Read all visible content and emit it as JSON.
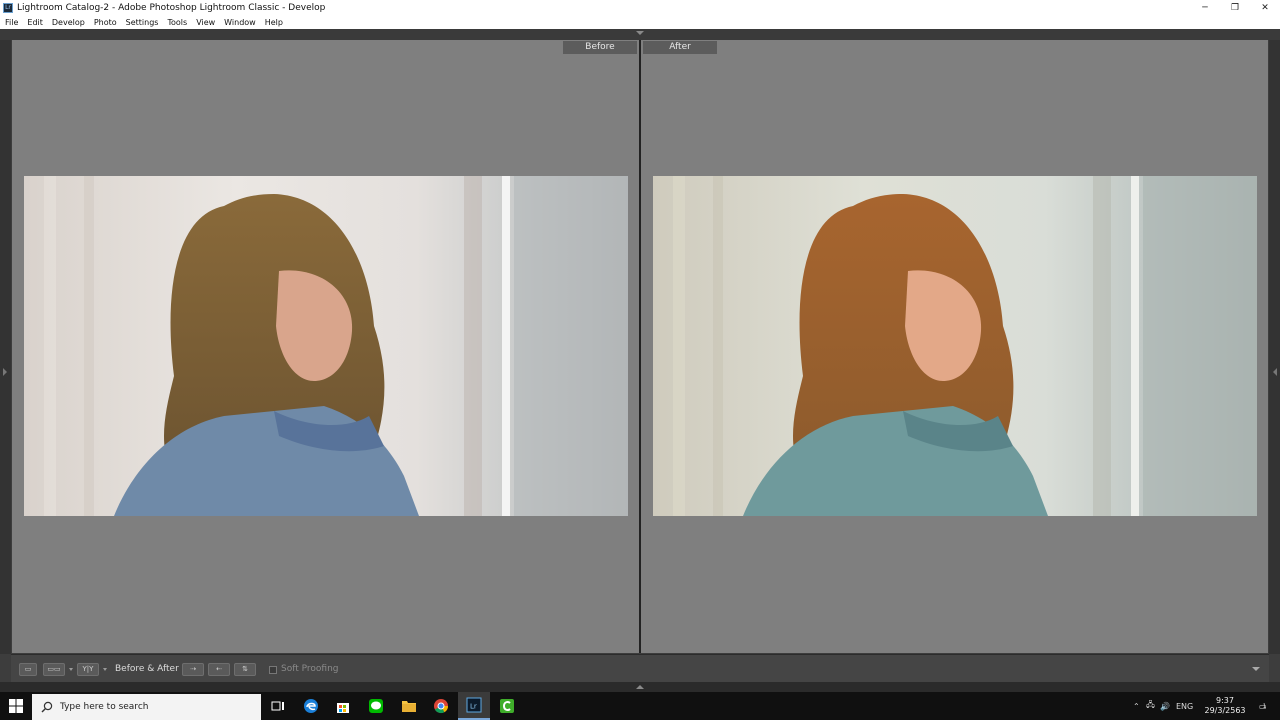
{
  "window": {
    "app_icon": "Lr",
    "title": "Lightroom Catalog-2 - Adobe Photoshop Lightroom Classic - Develop",
    "controls": {
      "minimize": "─",
      "restore": "❐",
      "close": "✕"
    }
  },
  "menu": {
    "items": [
      "File",
      "Edit",
      "Develop",
      "Photo",
      "Settings",
      "Tools",
      "View",
      "Window",
      "Help"
    ]
  },
  "compare": {
    "before_label": "Before",
    "after_label": "After"
  },
  "toolbar": {
    "loupe_icon": "loupe-view-icon",
    "compare_icon": "compare-view-icon",
    "before_after_mode_icon": "before-after-left-right-icon",
    "before_after_label": "Before & After :",
    "copy_before_to_after_icon": "copy-settings-icon",
    "copy_after_to_before_icon": "copy-settings-icon",
    "swap_icon": "swap-icon",
    "soft_proofing_label": "Soft Proofing",
    "soft_proofing_checked": false
  },
  "taskbar": {
    "search_placeholder": "Type here to search",
    "apps": [
      "task-view-icon",
      "edge-icon",
      "store-icon",
      "line-icon",
      "file-explorer-icon",
      "chrome-icon",
      "lightroom-icon",
      "camtasia-icon"
    ],
    "active_app": "lightroom-icon",
    "language": "ENG",
    "time": "9:37",
    "date": "29/3/2563",
    "notification_count": "1"
  },
  "colors": {
    "workspace_gray": "#7f7f7f",
    "panel_dark": "#3d3d3d",
    "taskbar": "#101010"
  }
}
